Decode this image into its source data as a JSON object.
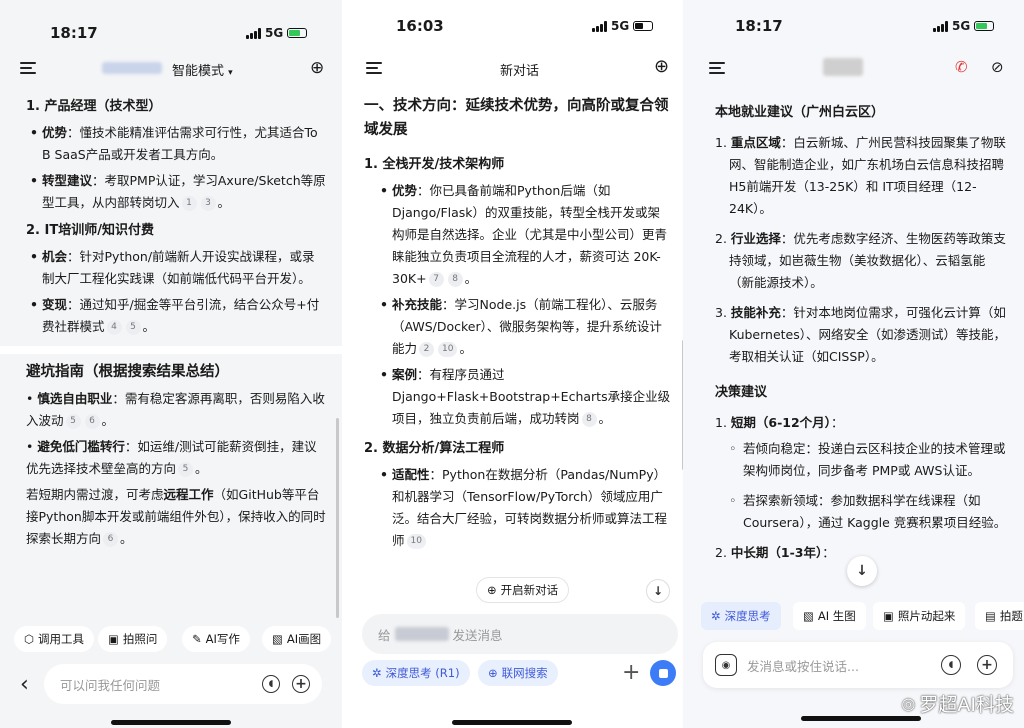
{
  "p1": {
    "time": "18:17",
    "net": "5G",
    "header": {
      "mode": "智能模式"
    },
    "s1": {
      "heading": "1. 产品经理（技术型）",
      "b1_key": "优势",
      "b1_text": "：懂技术能精准评估需求可行性，尤其适合To B SaaS产品或开发者工具方向。",
      "b2_key": "转型建议",
      "b2_text": "：考取PMP认证，学习Axure/Sketch等原型工具，从内部转岗切入",
      "b2_c1": "1",
      "b2_c2": "3"
    },
    "s2": {
      "heading": "2. IT培训师/知识付费",
      "b1_key": "机会",
      "b1_text": "：针对Python/前端新人开设实战课程，或录制大厂工程化实践课（如前端低代码平台开发）",
      "b2_key": "变现",
      "b2_text": "：通过知乎/掘金等平台引流，结合公众号+付费社群模式",
      "b2_c1": "4",
      "b2_c2": "5"
    },
    "s3": {
      "heading": "避坑指南（根据搜索结果总结）",
      "b1_key": "慎选自由职业",
      "b1_text": "：需有稳定客源再离职，否则易陷入收入波动",
      "b1_c1": "5",
      "b1_c2": "6",
      "b2_key": "避免低门槛转行",
      "b2_text": "：如运维/测试可能薪资倒挂，建议优先选择技术壁垒高的方向",
      "b2_c1": "5",
      "p_pre": "若短期内需过渡，可考虑",
      "p_key": "远程工作",
      "p_post": "（如GitHub等平台接Python脚本开发或前端组件外包），保持收入的同时探索长期方向",
      "p_c1": "6"
    },
    "toolbar": {
      "tools": "调用工具",
      "photo": "拍照问",
      "write": "AI写作",
      "draw": "AI画图"
    },
    "input": {
      "placeholder": "可以问我任何问题"
    }
  },
  "p2": {
    "time": "16:03",
    "net": "5G",
    "header": {
      "title": "新对话"
    },
    "h2": "一、技术方向：延续技术优势，向高阶或复合领域发展",
    "s1": {
      "heading": "1. 全栈开发/技术架构师",
      "b1_key": "优势",
      "b1_text": "：你已具备前端和Python后端（如Django/Flask）的双重技能，转型全栈开发或架构师是自然选择。企业（尤其是中小型公司）更青睐能独立负责项目全流程的人才，薪资可达 20K-30K+",
      "b1_c1": "7",
      "b1_c2": "8",
      "b2_key": "补充技能",
      "b2_text": "：学习Node.js（前端工程化）、云服务（AWS/Docker）、微服务架构等，提升系统设计能力",
      "b2_c1": "2",
      "b2_c2": "10",
      "b3_key": "案例",
      "b3_text": "：有程序员通过Django+Flask+Bootstrap+Echarts承接企业级项目，独立负责前后端，成功转岗",
      "b3_c1": "8"
    },
    "s2": {
      "heading": "2. 数据分析/算法工程师",
      "b1_key": "适配性",
      "b1_text": "：Python在数据分析（Pandas/NumPy）和机器学习（TensorFlow/PyTorch）领域应用广泛。结合大厂经验，可转岗数据分析师或算法工程师",
      "b1_c1": "10"
    },
    "newchat": "开启新对话",
    "input": {
      "pre": "给",
      "post": "发送消息"
    },
    "chips": {
      "deep": "深度思考 (R1)",
      "search": "联网搜索"
    }
  },
  "p3": {
    "time": "18:17",
    "net": "5G",
    "h1": "本地就业建议（广州白云区）",
    "l1_key": "重点区域",
    "l1_text": "：白云新城、广州民营科技园聚集了物联网、智能制造企业，如广东机场白云信息科技招聘 H5前端开发（13-25K）和 IT项目经理（12-24K）。",
    "l2_key": "行业选择",
    "l2_text": "：优先考虑数字经济、生物医药等政策支持领域，如岜薇生物（美妆数据化）、云韬氢能（新能源技术）。",
    "l3_key": "技能补充",
    "l3_text": "：针对本地岗位需求，可强化云计算（如 Kubernetes）、网络安全（如渗透测试）等技能，考取相关认证（如CISSP）。",
    "h2": "决策建议",
    "d1_key": "短期（6-12个月）",
    "d1_colon": "：",
    "d1_a": "若倾向稳定：投递白云区科技企业的技术管理或架构师岗位，同步备考 PMP或 AWS认证。",
    "d1_b": "若探索新领域：参加数据科学在线课程（如 Coursera），通过 Kaggle 竞赛积累项目经验。",
    "d2_key": "中长期（1-3年）",
    "d2_colon": "：",
    "chips": {
      "deep": "深度思考",
      "img": "AI 生图",
      "anim": "照片动起来",
      "more": "拍题"
    },
    "input": {
      "placeholder": "发消息或按住说话..."
    }
  },
  "watermark": "罗超AI科技",
  "colors": {
    "accent": "#4f6ef7",
    "chip_bg": "#e8effd",
    "send": "#3c7cf6"
  }
}
